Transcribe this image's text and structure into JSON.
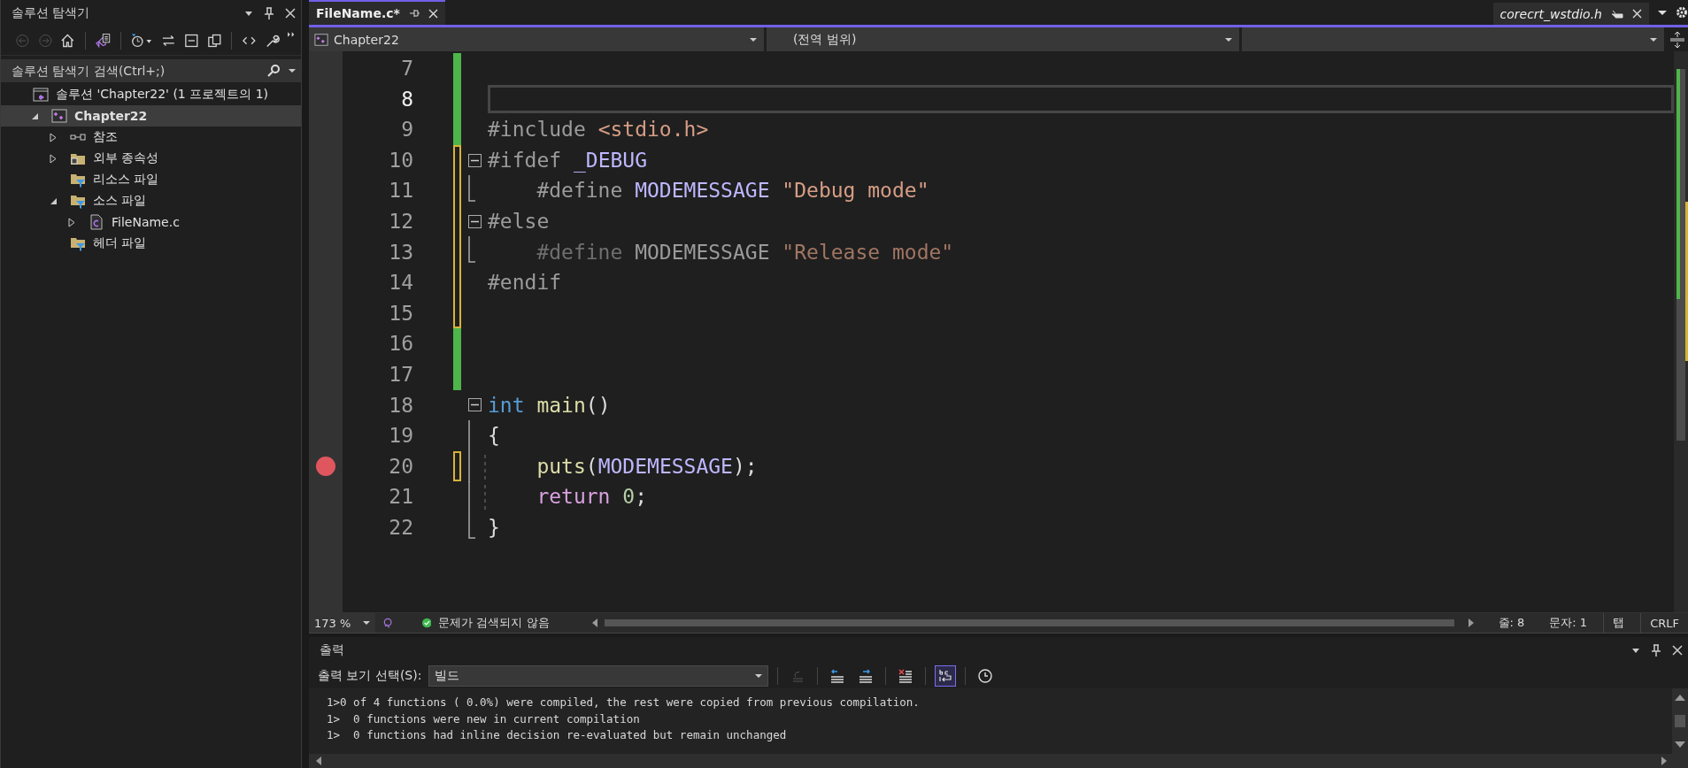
{
  "solution_explorer": {
    "title": "솔루션 탐색기",
    "tools": [
      {
        "kind": "back",
        "disabled": true
      },
      {
        "kind": "forward",
        "disabled": true
      },
      {
        "kind": "home",
        "disabled": false
      },
      {
        "kind": "switch-views",
        "disabled": false
      },
      {
        "kind": "history",
        "disabled": false
      },
      {
        "kind": "sync",
        "disabled": false
      },
      {
        "kind": "collapse",
        "disabled": false
      },
      {
        "kind": "show-all",
        "disabled": false
      },
      {
        "kind": "code",
        "disabled": false
      },
      {
        "kind": "properties",
        "disabled": false
      }
    ],
    "search": {
      "placeholder": "솔루션 탐색기 검색(Ctrl+;)"
    },
    "tree": [
      {
        "label": "솔루션 'Chapter22' (1 프로젝트의 1)",
        "kind": "solution",
        "selected": false,
        "children": [
          {
            "label": "Chapter22",
            "kind": "project",
            "expanded": true,
            "selected": true,
            "children": [
              {
                "label": "참조",
                "kind": "references",
                "expanded": false,
                "selected": false
              },
              {
                "label": "외부 종속성",
                "kind": "external",
                "expanded": false,
                "selected": false
              },
              {
                "label": "리소스 파일",
                "kind": "filter",
                "selected": false
              },
              {
                "label": "소스 파일",
                "kind": "filter",
                "expanded": true,
                "selected": false,
                "children": [
                  {
                    "label": "FileName.c",
                    "kind": "cfile",
                    "expanded": false,
                    "selected": false
                  }
                ]
              },
              {
                "label": "헤더 파일",
                "kind": "filter",
                "selected": false
              }
            ]
          }
        ]
      }
    ]
  },
  "editor": {
    "tabs": [
      {
        "label": "FileName.c*",
        "selected": true,
        "preview": false
      },
      {
        "label": "corecrt_wstdio.h",
        "selected": false,
        "preview": true
      }
    ],
    "navigation": {
      "project": "Chapter22",
      "scope": "(전역 범위)"
    },
    "lines": [
      {
        "number": "7",
        "current": false,
        "breakpoint": false,
        "modified": true,
        "saved": true,
        "fold_start": false,
        "in_fold": false
      },
      {
        "number": "8",
        "current": true,
        "breakpoint": false,
        "modified": true,
        "saved": true,
        "fold_start": false,
        "in_fold": false
      },
      {
        "number": "9",
        "current": false,
        "breakpoint": false,
        "modified": true,
        "saved": true,
        "fold_start": false,
        "in_fold": false,
        "tokens": [
          {
            "t": "#include ",
            "kind": "directive"
          },
          {
            "t": "<stdio.h>",
            "kind": "string"
          }
        ]
      },
      {
        "number": "10",
        "current": false,
        "breakpoint": false,
        "modified": true,
        "saved": false,
        "fold_start": true,
        "in_fold": false,
        "tokens": [
          {
            "t": "#ifdef ",
            "kind": "directive"
          },
          {
            "t": "_DEBUG",
            "kind": "macro"
          }
        ]
      },
      {
        "number": "11",
        "current": false,
        "breakpoint": false,
        "modified": true,
        "saved": false,
        "fold_start": false,
        "in_fold": true,
        "tokens": [
          {
            "t": "    #define ",
            "kind": "directive"
          },
          {
            "t": "MODEMESSAGE ",
            "kind": "macro"
          },
          {
            "t": "\"Debug mode\"",
            "kind": "string"
          }
        ]
      },
      {
        "number": "12",
        "current": false,
        "breakpoint": false,
        "modified": true,
        "saved": false,
        "fold_start": true,
        "in_fold": false,
        "tokens": [
          {
            "t": "#else",
            "kind": "directive"
          }
        ]
      },
      {
        "number": "13",
        "current": false,
        "breakpoint": false,
        "modified": true,
        "saved": false,
        "fold_start": false,
        "in_fold": true,
        "tokens": [
          {
            "t": "    #define ",
            "kind": "inactive"
          },
          {
            "t": "MODEMESSAGE ",
            "kind": "inactive-macro"
          },
          {
            "t": "\"Release mode\"",
            "kind": "inactive-string"
          }
        ]
      },
      {
        "number": "14",
        "current": false,
        "breakpoint": false,
        "modified": true,
        "saved": false,
        "fold_start": false,
        "in_fold": false,
        "tokens": [
          {
            "t": "#endif",
            "kind": "directive"
          }
        ]
      },
      {
        "number": "15",
        "current": false,
        "breakpoint": false,
        "modified": true,
        "saved": false,
        "fold_start": false,
        "in_fold": false
      },
      {
        "number": "16",
        "current": false,
        "breakpoint": false,
        "modified": true,
        "saved": true,
        "fold_start": false,
        "in_fold": false
      },
      {
        "number": "17",
        "current": false,
        "breakpoint": false,
        "modified": true,
        "saved": true,
        "fold_start": false,
        "in_fold": false
      },
      {
        "number": "18",
        "current": false,
        "breakpoint": false,
        "modified": false,
        "saved": false,
        "fold_start": true,
        "in_fold": false,
        "tokens": [
          {
            "t": "int ",
            "kind": "keyword"
          },
          {
            "t": "main",
            "kind": "function"
          },
          {
            "t": "()",
            "kind": "plain"
          }
        ]
      },
      {
        "number": "19",
        "current": false,
        "breakpoint": false,
        "modified": false,
        "saved": false,
        "fold_start": false,
        "in_fold": true,
        "tokens": [
          {
            "t": "{",
            "kind": "plain"
          }
        ]
      },
      {
        "number": "20",
        "current": false,
        "breakpoint": true,
        "modified": true,
        "saved": false,
        "fold_start": false,
        "in_fold": true,
        "tokens": [
          {
            "t": "    puts",
            "kind": "function"
          },
          {
            "t": "(",
            "kind": "plain"
          },
          {
            "t": "MODEMESSAGE",
            "kind": "macro"
          },
          {
            "t": ");",
            "kind": "plain"
          }
        ]
      },
      {
        "number": "21",
        "current": false,
        "breakpoint": false,
        "modified": false,
        "saved": false,
        "fold_start": false,
        "in_fold": true,
        "tokens": [
          {
            "t": "    return ",
            "kind": "control"
          },
          {
            "t": "0",
            "kind": "number"
          },
          {
            "t": ";",
            "kind": "plain"
          }
        ]
      },
      {
        "number": "22",
        "current": false,
        "breakpoint": false,
        "modified": false,
        "saved": false,
        "fold_start": false,
        "in_fold": true,
        "tokens": [
          {
            "t": "}",
            "kind": "plain"
          }
        ]
      }
    ],
    "status": {
      "zoom": "173 %",
      "issues": "문제가 검색되지 않음",
      "line": "줄: 8",
      "column": "문자: 1",
      "indent": "탭",
      "line_ending": "CRLF"
    }
  },
  "output": {
    "title": "출력",
    "source_label": "출력 보기 선택(S):",
    "source": "빌드",
    "tools": [
      {
        "kind": "go-to-line",
        "disabled": true,
        "on": false
      },
      {
        "kind": "previous",
        "disabled": false,
        "on": false
      },
      {
        "kind": "next",
        "disabled": false,
        "on": false
      },
      {
        "kind": "clear",
        "disabled": false,
        "on": false
      },
      {
        "kind": "word-wrap",
        "disabled": false,
        "on": true
      },
      {
        "kind": "timestamps",
        "disabled": false,
        "on": false
      }
    ],
    "lines": [
      "1>0 of 4 functions ( 0.0%) were compiled, the rest were copied from previous compilation.",
      "1>  0 functions were new in current compilation",
      "1>  0 functions had inline decision re-evaluated but remain unchanged"
    ]
  }
}
